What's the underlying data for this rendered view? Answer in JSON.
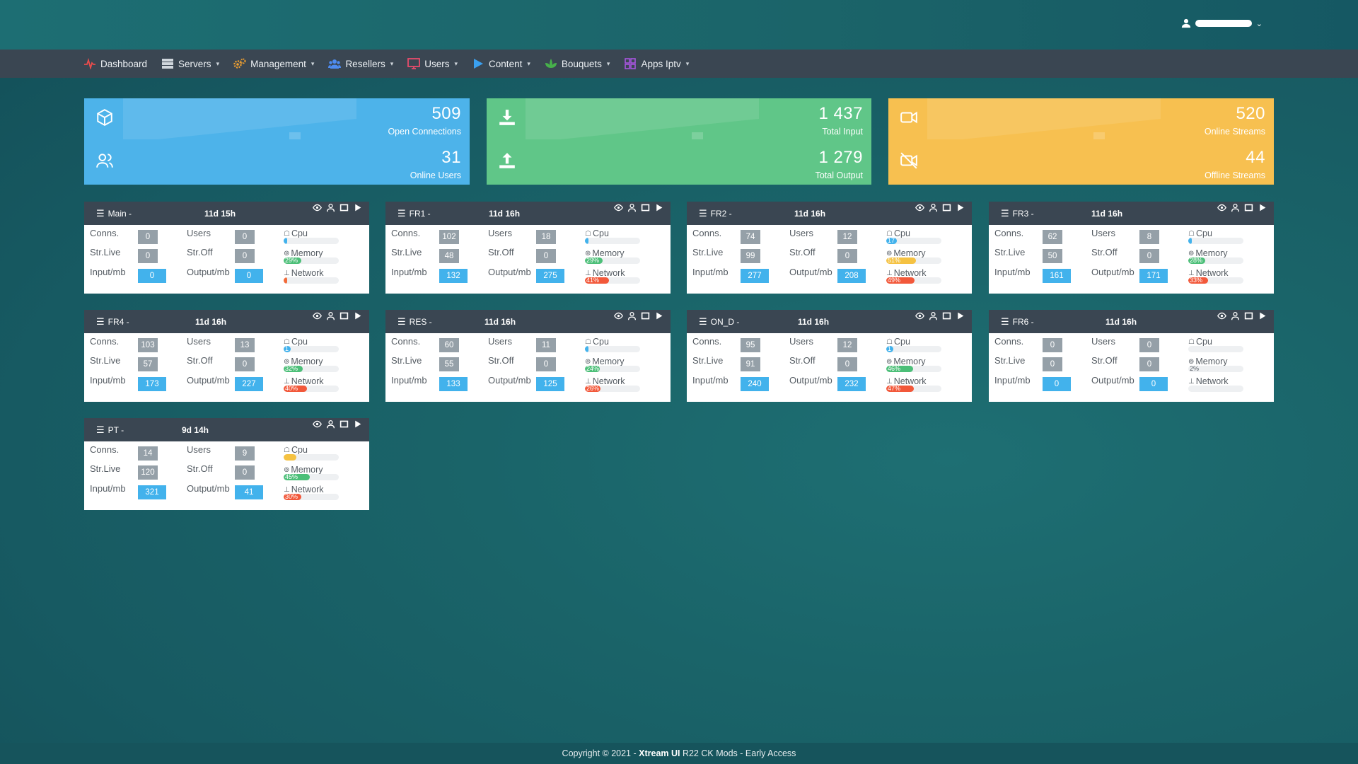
{
  "user_menu": {
    "chevron": "⌄"
  },
  "nav": [
    {
      "label": "Dashboard",
      "icon": "pulse-icon",
      "color": "#e84c4c",
      "caret": false
    },
    {
      "label": "Servers",
      "icon": "server-icon",
      "color": "#cfd6dc",
      "caret": true
    },
    {
      "label": "Management",
      "icon": "gears-icon",
      "color": "#f0a030",
      "caret": true
    },
    {
      "label": "Resellers",
      "icon": "users-group-icon",
      "color": "#4e8cf0",
      "caret": true
    },
    {
      "label": "Users",
      "icon": "monitor-icon",
      "color": "#e84c6c",
      "caret": true
    },
    {
      "label": "Content",
      "icon": "play-icon",
      "color": "#3aa0f0",
      "caret": true
    },
    {
      "label": "Bouquets",
      "icon": "leaf-icon",
      "color": "#47b04b",
      "caret": true
    },
    {
      "label": "Apps Iptv",
      "icon": "apps-grid-icon",
      "color": "#a855e0",
      "caret": true
    }
  ],
  "stats": {
    "blue": {
      "value_a": "509",
      "label_a": "Open Connections",
      "value_b": "31",
      "label_b": "Online Users"
    },
    "green": {
      "value_a": "1 437",
      "label_a": "Total Input",
      "value_b": "1 279",
      "label_b": "Total Output"
    },
    "yellow": {
      "value_a": "520",
      "label_a": "Online Streams",
      "value_b": "44",
      "label_b": "Offline Streams"
    }
  },
  "card_labels": {
    "conns": "Conns.",
    "users": "Users",
    "str_live": "Str.Live",
    "str_off": "Str.Off",
    "input": "Input/mb",
    "output": "Output/mb",
    "cpu": "Cpu",
    "memory": "Memory",
    "network": "Network"
  },
  "servers": [
    {
      "name": "Main -",
      "uptime": "11d 15h",
      "conns": "0",
      "users": "0",
      "str_live": "0",
      "str_off": "0",
      "input": "0",
      "output": "0",
      "cpu": 0.03,
      "cpu_text": "",
      "mem": 0.29,
      "mem_text": "29%",
      "mem_color": "#4cbf78",
      "net": 0.02,
      "net_text": "",
      "net_color": "#f26b3a"
    },
    {
      "name": "FR1 -",
      "uptime": "11d 16h",
      "conns": "102",
      "users": "18",
      "str_live": "48",
      "str_off": "0",
      "input": "132",
      "output": "275",
      "cpu": 0.03,
      "cpu_text": "",
      "mem": 0.29,
      "mem_text": "29%",
      "mem_color": "#4cbf78",
      "net": 0.41,
      "net_text": "41%",
      "net_color": "#f2583a"
    },
    {
      "name": "FR2 -",
      "uptime": "11d 16h",
      "conns": "74",
      "users": "12",
      "str_live": "99",
      "str_off": "0",
      "input": "277",
      "output": "208",
      "cpu": 0.17,
      "cpu_text": "17",
      "mem": 0.51,
      "mem_text": "51%",
      "mem_color": "#f5c242",
      "net": 0.49,
      "net_text": "49%",
      "net_color": "#f2583a"
    },
    {
      "name": "FR3 -",
      "uptime": "11d 16h",
      "conns": "62",
      "users": "8",
      "str_live": "50",
      "str_off": "0",
      "input": "161",
      "output": "171",
      "cpu": 0.03,
      "cpu_text": "",
      "mem": 0.28,
      "mem_text": "28%",
      "mem_color": "#4cbf78",
      "net": 0.33,
      "net_text": "33%",
      "net_color": "#f2583a"
    },
    {
      "name": "FR4 -",
      "uptime": "11d 16h",
      "conns": "103",
      "users": "13",
      "str_live": "57",
      "str_off": "0",
      "input": "173",
      "output": "227",
      "cpu": 0.1,
      "cpu_text": "1",
      "mem": 0.32,
      "mem_text": "32%",
      "mem_color": "#4cbf78",
      "net": 0.4,
      "net_text": "40%",
      "net_color": "#f2583a"
    },
    {
      "name": "RES -",
      "uptime": "11d 16h",
      "conns": "60",
      "users": "11",
      "str_live": "55",
      "str_off": "0",
      "input": "133",
      "output": "125",
      "cpu": 0.03,
      "cpu_text": "",
      "mem": 0.24,
      "mem_text": "24%",
      "mem_color": "#4cbf78",
      "net": 0.26,
      "net_text": "26%",
      "net_color": "#f2583a"
    },
    {
      "name": "ON_D -",
      "uptime": "11d 16h",
      "conns": "95",
      "users": "12",
      "str_live": "91",
      "str_off": "0",
      "input": "240",
      "output": "232",
      "cpu": 0.1,
      "cpu_text": "1",
      "mem": 0.46,
      "mem_text": "46%",
      "mem_color": "#4cbf78",
      "net": 0.47,
      "net_text": "47%",
      "net_color": "#f2583a"
    },
    {
      "name": "FR6 -",
      "uptime": "11d 16h",
      "conns": "0",
      "users": "0",
      "str_live": "0",
      "str_off": "0",
      "input": "0",
      "output": "0",
      "cpu": 0.0,
      "cpu_text": "",
      "mem": 0.0,
      "mem_text": "2%",
      "mem_color": "#4cbf78",
      "net": 0.0,
      "net_text": "",
      "net_color": "#f2583a"
    },
    {
      "name": "PT -",
      "uptime": "9d 14h",
      "conns": "14",
      "users": "9",
      "str_live": "120",
      "str_off": "0",
      "input": "321",
      "output": "41",
      "cpu": 0.2,
      "cpu_text": "",
      "mem": 0.45,
      "mem_text": "45%",
      "mem_color": "#4cbf78",
      "net": 0.3,
      "net_text": "30%",
      "net_color": "#f2583a",
      "cpu_color": "#f5c242"
    }
  ],
  "footer": {
    "prefix": "Copyright © 2021 - ",
    "brand": "Xtream UI",
    "suffix": " R22 CK Mods - Early Access"
  }
}
